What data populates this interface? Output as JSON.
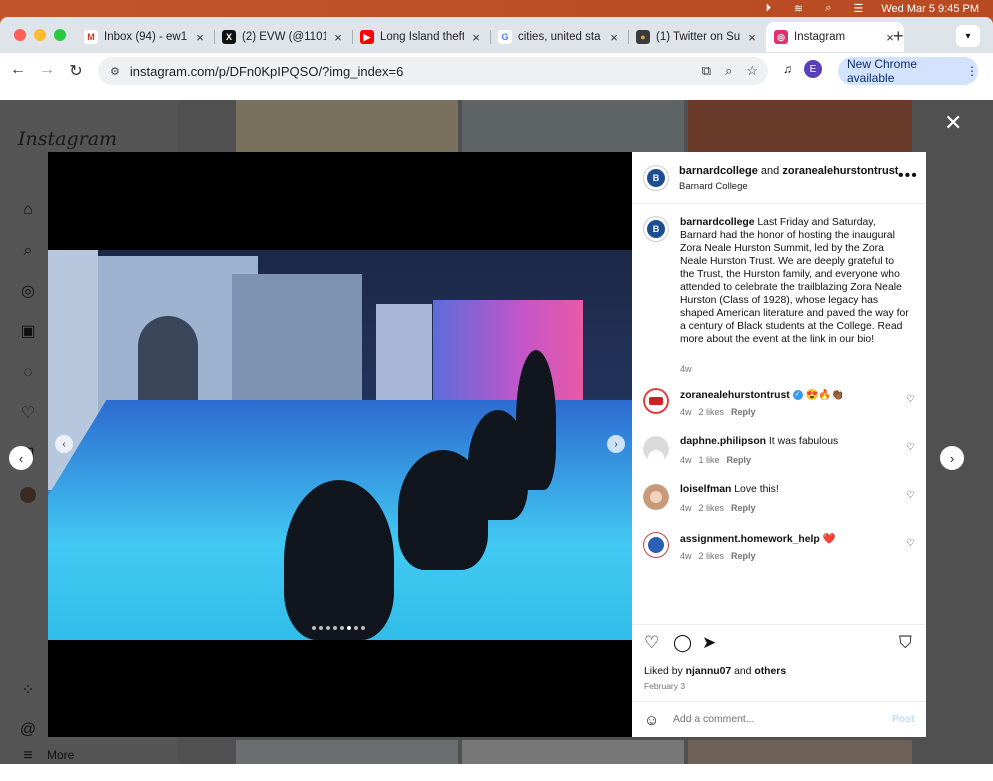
{
  "menubar": {
    "datetime": "Wed Mar 5  9:45 PM"
  },
  "tabs": [
    {
      "label": "Inbox (94) - ew1",
      "favicon_color": "#ffffff",
      "favicon_glyph": "M",
      "favicon_text_color": "#d93025"
    },
    {
      "label": "(2) EVW (@1101",
      "favicon_color": "#111111",
      "favicon_glyph": "X",
      "favicon_text_color": "#ffffff"
    },
    {
      "label": "Long Island theft",
      "favicon_color": "#ff0000",
      "favicon_glyph": "▶",
      "favicon_text_color": "#ffffff"
    },
    {
      "label": "cities, united sta",
      "favicon_color": "#ffffff",
      "favicon_glyph": "G",
      "favicon_text_color": "#4285f4"
    },
    {
      "label": "(1) Twitter on Su",
      "favicon_color": "#3a3a3a",
      "favicon_glyph": "●",
      "favicon_text_color": "#d9a441"
    },
    {
      "label": "Instagram",
      "favicon_color": "#e1306c",
      "favicon_glyph": "◎",
      "favicon_text_color": "#ffffff"
    }
  ],
  "address": {
    "url": "instagram.com/p/DFn0KpIPQSO/?img_index=6"
  },
  "profile_initial": "E",
  "update_banner": "New Chrome available",
  "instagram": {
    "logo": "Instagram",
    "more_label": "More"
  },
  "post": {
    "header_user1": "barnardcollege",
    "header_and": "and",
    "header_user2": "zoranealehurstontrust",
    "location": "Barnard College",
    "caption_user": "barnardcollege",
    "caption_text": "Last Friday and Saturday, Barnard had the honor of hosting the inaugural Zora Neale Hurston Summit, led by the Zora Neale Hurston Trust. We are deeply grateful to the Trust, the Hurston family, and everyone who attended to celebrate the trailblazing Zora Neale Hurston (Class of 1928), whose legacy has shaped American literature and paved the way for a century of Black students at the College. Read more about the event at the link in our bio!",
    "caption_time": "4w",
    "comments": [
      {
        "user": "zoranealehurstontrust",
        "text": "😍🔥👏🏾",
        "time": "4w",
        "likes": "2 likes",
        "reply": "Reply"
      },
      {
        "user": "daphne.philipson",
        "text": "It was fabulous",
        "time": "4w",
        "likes": "1 like",
        "reply": "Reply"
      },
      {
        "user": "loiselfman",
        "text": "Love this!",
        "time": "4w",
        "likes": "2 likes",
        "reply": "Reply"
      },
      {
        "user": "assignment.homework_help",
        "text": "❤️",
        "time": "4w",
        "likes": "2 likes",
        "reply": "Reply"
      }
    ],
    "liked_prefix": "Liked by",
    "liked_user": "njannu07",
    "liked_and": "and",
    "liked_others": "others",
    "date": "February 3",
    "add_comment_placeholder": "Add a comment...",
    "post_label": "Post"
  },
  "carousel": {
    "count": 8,
    "active_index": 6
  },
  "colors": {
    "accent": "#0095f6",
    "menubar": "#c2552a",
    "update_pill": "#d3e3fd"
  }
}
